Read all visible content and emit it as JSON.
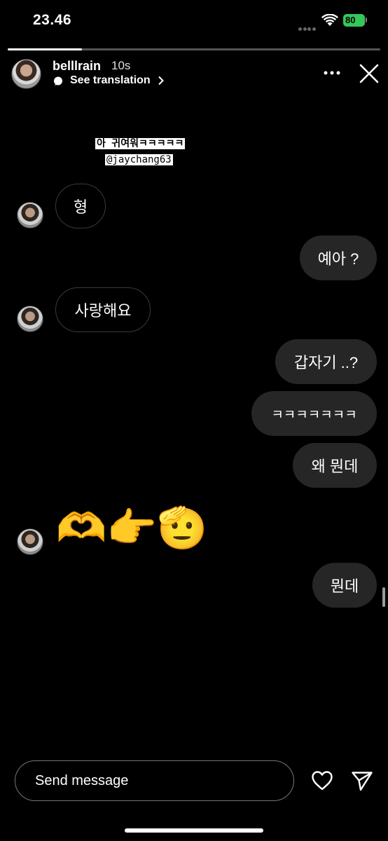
{
  "status_bar": {
    "time": "23.46",
    "battery": "80"
  },
  "story": {
    "progress": 0.2,
    "username": "belllrain",
    "time_ago": "10s",
    "translation_label": "See translation",
    "caption_line1": "아 귀여워ㅋㅋㅋㅋㅋ",
    "caption_line2": "@jaychang63"
  },
  "messages": [
    {
      "side": "received",
      "text": "형"
    },
    {
      "side": "sent",
      "text": "예아 ?"
    },
    {
      "side": "received",
      "text": "사랑해요"
    },
    {
      "side": "sent",
      "text": "갑자기 ..?"
    },
    {
      "side": "sent",
      "text": "ㅋㅋㅋㅋㅋㅋㅋ"
    },
    {
      "side": "sent",
      "text": "왜 뭔데"
    },
    {
      "side": "received",
      "text": "🫶👉🫡"
    },
    {
      "side": "sent",
      "text": "뭔데"
    }
  ],
  "composer": {
    "placeholder": "Send message"
  },
  "icons": [
    "wifi-icon",
    "battery-icon",
    "more-icon",
    "close-icon",
    "heart-icon",
    "send-icon",
    "translate-icon",
    "chevron-right-icon"
  ],
  "colors": {
    "background": "#000000",
    "sent_bubble": "#262626",
    "battery_green": "#34c759"
  }
}
